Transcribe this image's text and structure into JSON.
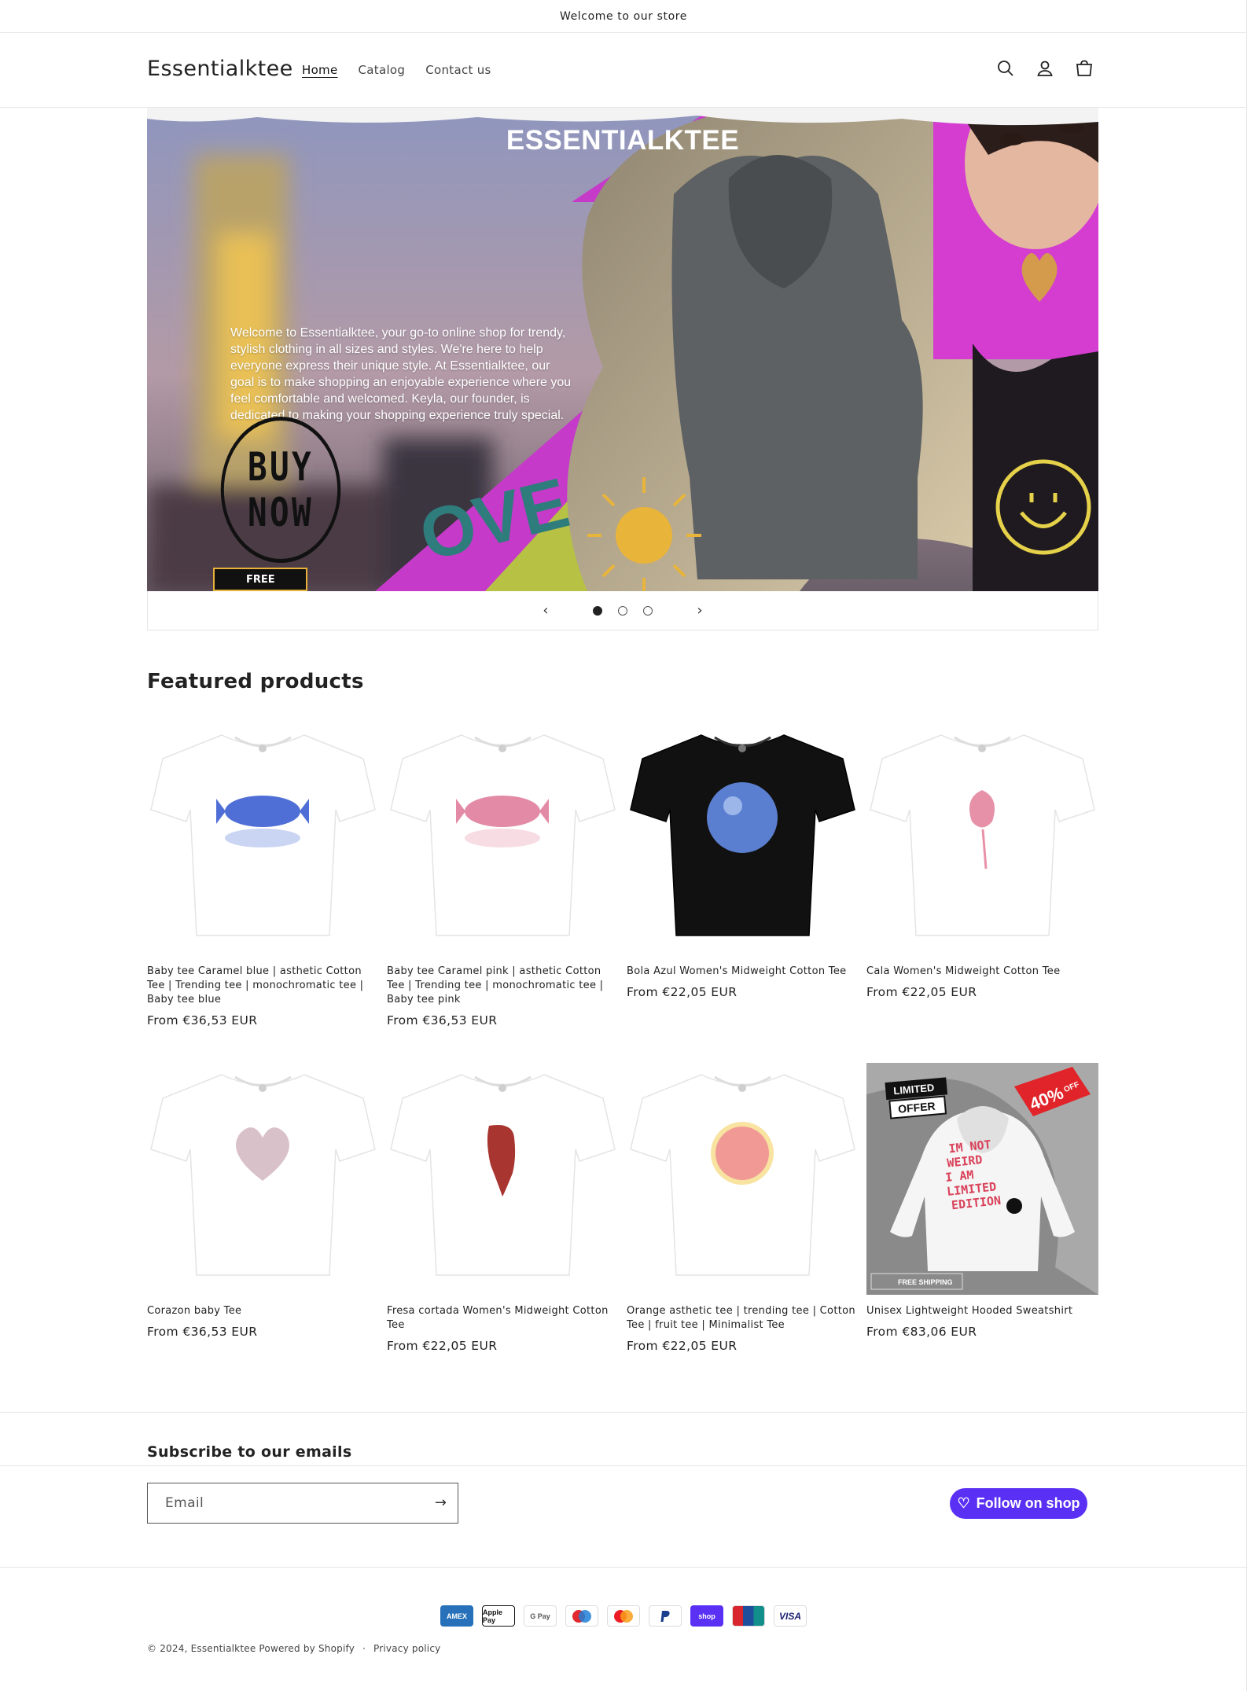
{
  "announcement": "Welcome to our store",
  "header": {
    "logo": "Essentialktee",
    "nav": [
      {
        "label": "Home",
        "active": true
      },
      {
        "label": "Catalog",
        "active": false
      },
      {
        "label": "Contact us",
        "active": false
      }
    ],
    "icons": [
      "search-icon",
      "account-icon",
      "cart-icon"
    ]
  },
  "hero": {
    "title": "ESSENTIALKTEE",
    "text": "Welcome to Essentialktee, your go-to online shop for trendy, stylish clothing in all sizes and styles. We're here to help everyone express their unique style. At Essentialktee, our goal is to make shopping an enjoyable experience where you feel comfortable and welcomed. Keyla, our founder, is dedicated to making your shopping experience truly special.",
    "badge_line1": "BUY",
    "badge_line2": "NOW",
    "free_label": "FREE",
    "slides": 3,
    "active_slide": 1
  },
  "featured": {
    "title": "Featured products",
    "products": [
      {
        "name": "Baby tee Caramel blue | asthetic Cotton Tee | Trending tee | monochromatic tee | Baby tee blue",
        "price": "From €36,53 EUR",
        "shirt": "#ffffff",
        "print": "#4f6fd6"
      },
      {
        "name": "Baby tee Caramel pink | asthetic Cotton Tee | Trending tee | monochromatic tee | Baby tee pink",
        "price": "From €36,53 EUR",
        "shirt": "#ffffff",
        "print": "#e38aa6"
      },
      {
        "name": "Bola Azul Women's Midweight Cotton Tee",
        "price": "From €22,05 EUR",
        "shirt": "#111111",
        "print": "#5b7fd0"
      },
      {
        "name": "Cala Women's Midweight Cotton Tee",
        "price": "From €22,05 EUR",
        "shirt": "#ffffff",
        "print": "#e791a8"
      },
      {
        "name": "Corazon baby Tee",
        "price": "From €36,53 EUR",
        "shirt": "#ffffff",
        "print": "#c9a6b3"
      },
      {
        "name": "Fresa cortada Women's Midweight Cotton Tee",
        "price": "From €22,05 EUR",
        "shirt": "#ffffff",
        "print": "#a8352f"
      },
      {
        "name": "Orange asthetic tee | trending tee | Cotton Tee | fruit tee | Minimalist Tee",
        "price": "From €22,05 EUR",
        "shirt": "#ffffff",
        "print": "#f19a95"
      },
      {
        "name": "Unisex Lightweight Hooded Sweatshirt",
        "price": "From €83,06 EUR",
        "shirt": "#ffffff",
        "print": "#d9425a"
      }
    ],
    "promo": {
      "limited": "LIMITED",
      "offer": "OFFER",
      "discount": "40%",
      "off": "OFF",
      "slogan": "IM NOT WEIRD I AM LIMITED EDITION",
      "shipping": "FREE SHIPPING"
    }
  },
  "newsletter": {
    "title": "Subscribe to our emails",
    "placeholder": "Email"
  },
  "follow": "Follow on shop",
  "payments": [
    "AMEX",
    "Apple Pay",
    "G Pay",
    "Maestro",
    "Mastercard",
    "PayPal",
    "shop",
    "UnionPay",
    "VISA"
  ],
  "footer": {
    "copyright": "© 2024, Essentialktee",
    "powered": "Powered by Shopify",
    "privacy": "Privacy policy"
  },
  "colors": {
    "accent": "#5a31f4",
    "hero_magenta": "#c63ac9",
    "hero_lime": "#b7c244"
  }
}
